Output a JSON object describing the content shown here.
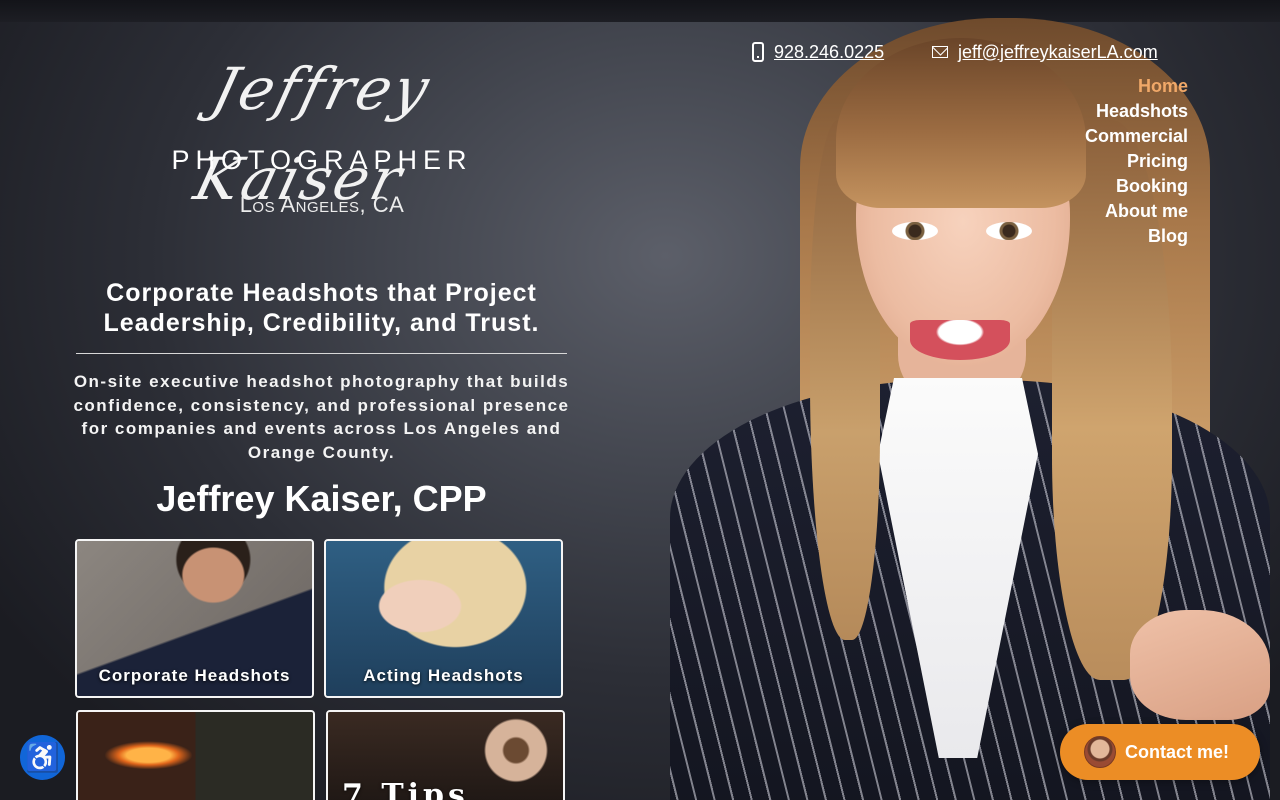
{
  "header": {
    "phone": "928.246.0225",
    "email": "jeff@jeffreykaiserLA.com"
  },
  "logo": {
    "script_name": "Jeffrey Kaiser",
    "subtitle": "PHOTOGRAPHER",
    "location": "Los Angeles, CA"
  },
  "nav": {
    "items": [
      {
        "label": "Home",
        "active": true
      },
      {
        "label": "Headshots",
        "active": false
      },
      {
        "label": "Commercial",
        "active": false
      },
      {
        "label": "Pricing",
        "active": false
      },
      {
        "label": "Booking",
        "active": false
      },
      {
        "label": "About me",
        "active": false
      },
      {
        "label": "Blog",
        "active": false
      }
    ]
  },
  "hero": {
    "title": "Corporate Headshots that Project Leadership, Credibility, and Trust.",
    "description": "On-site executive headshot photography that builds confidence, consistency, and professional presence for companies and events across Los Angeles and Orange County.",
    "name": "Jeffrey Kaiser, CPP"
  },
  "tiles": {
    "corporate": "Corporate Headshots",
    "acting": "Acting Headshots",
    "tips": "7 Tips"
  },
  "widgets": {
    "contact_label": "Contact me!",
    "accessibility_icon": "accessibility-icon"
  },
  "colors": {
    "nav_active": "#f0a868",
    "contact_button": "#ec8d25",
    "accessibility_button": "#1166d8"
  }
}
